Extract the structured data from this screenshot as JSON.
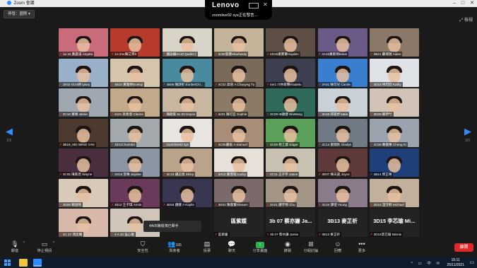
{
  "window": {
    "title": "Zoom 會議",
    "controls": [
      "–",
      "□",
      "✕"
    ]
  },
  "topbar": {
    "view_button": "停發：國際 ▾",
    "speaking": "zoomlive02 sys正在發言...",
    "fullscreen": "⤢ 檢視"
  },
  "lenovo": {
    "logo": "Lenovo"
  },
  "gallery": {
    "page_left": "1/3",
    "page_right": "3/3",
    "tiles": [
      {
        "name": "1a 15 黃晨溪 Angela",
        "bg": "#c96b7a"
      },
      {
        "name": "1A Zoe陳艾邦6",
        "bg": "#b83a2d"
      },
      {
        "name": "鍾詠姍4A10 Qudim (",
        "bg": "#d9d4c8"
      },
      {
        "name": "3c05張禮Hilarhasity",
        "bg": "#c4b59a"
      },
      {
        "name": "4D15潘寶寶Hayden",
        "bg": "#5e5047"
      },
      {
        "name": "4A15黃家晴katun",
        "bg": "#6b5a86"
      },
      {
        "name": "3B21 蕭瑞瑞 Aiden",
        "bg": "#8a7868"
      },
      {
        "name": "2E02 IS24婷 Ipsey",
        "bg": "#9ab0c8"
      },
      {
        "name": "4B10 黃雅婷Doeluji",
        "bg": "#d6c5ad"
      },
      {
        "name": "4B06 陳詩形 EunbeiChi...",
        "bg": "#4a8a9e"
      },
      {
        "name": "4C02 高晉 A Chauyng Tu",
        "bg": "#7a6a5a"
      },
      {
        "name": "4er1 IT林家聲Klu&Mu",
        "bg": "#3f3f52"
      },
      {
        "name": "3A01 陳可兒 Carole",
        "bg": "#3a7fcf"
      },
      {
        "name": "3D18 林可欣 Kathy",
        "bg": "#dfe3e8"
      },
      {
        "name": "3C18 黃樂 Jamie",
        "bg": "#9fa7b0"
      },
      {
        "name": "4c21 高希意 Clarice",
        "bg": "#c2a98a"
      },
      {
        "name": "陳朗家 5c 02 Hoyce",
        "bg": "#c8b6a0"
      },
      {
        "name": "4c01 陳可宜 Sophie",
        "bg": "#8a7a66"
      },
      {
        "name": "3C29 IB康健 WuWang",
        "bg": "#2f6a5a"
      },
      {
        "name": "3A18 邱家妤 katie",
        "bg": "#c9d0d6"
      },
      {
        "name": "3D28 鄭伊兮",
        "bg": "#d1c3b5"
      },
      {
        "name": "3B19_MO WING YAN",
        "bg": "#4d3a2e"
      },
      {
        "name": "4b31Charlotte",
        "bg": "#a3a8ad"
      },
      {
        "name": "zoomlive02 sys",
        "bg": "#e8e4df"
      },
      {
        "name": "3C05蕭振 A Samuel",
        "bg": "#a88e78"
      },
      {
        "name": "3C06 姓江晨 Edgar",
        "bg": "#5aa05a"
      },
      {
        "name": "4C14 劉曉秋 Gladys",
        "bg": "#6f7a85"
      },
      {
        "name": "4C08 賴嘉樂 Cheng Ki",
        "bg": "#9aa3ae"
      },
      {
        "name": "3C05 陳家焉 Wayne",
        "bg": "#4a2f3f"
      },
      {
        "name": "4D15 李樂 Jaydee",
        "bg": "#8c95a3"
      },
      {
        "name": "3C23 鍾志偉 Shiny",
        "bg": "#b9a38b"
      },
      {
        "name": "3A12 黃雪瑤 Lucky",
        "bg": "#e6e0d8"
      },
      {
        "name": "3C11 王子宇 Jason",
        "bg": "#c8c0b0"
      },
      {
        "name": "3D07 賴天晨 Joyce",
        "bg": "#5e3a3a"
      },
      {
        "name": "4B14 郭芷晴",
        "bg": "#1e3f7a"
      },
      {
        "name": "4D08 賴語晴",
        "bg": "#d8c9b8"
      },
      {
        "name": "4b12 王子琪 Annie",
        "bg": "#6b3a5a"
      },
      {
        "name": "4D04 鍾健 A Kaylie",
        "bg": "#3a3550"
      },
      {
        "name": "3D02 陳嘉賢Sheuen",
        "bg": "#7a6a6a"
      },
      {
        "name": "3A21 鍾宇晴 Chu",
        "bg": "#a39585"
      },
      {
        "name": "4C24 譚愷 Yeung",
        "bg": "#8a7a8a"
      },
      {
        "name": "3D16 溫守軒 Michael",
        "bg": "#c2b09c"
      },
      {
        "name": "4C 27 馮思曦",
        "bg": "#d8b8a8"
      },
      {
        "name": "4 A 33 吳心雅",
        "bg": "#cfc5b8"
      }
    ],
    "text_tiles": [
      {
        "big": "區紫媛",
        "name": "區紫媛"
      },
      {
        "big": "3b 07 蔡亦謙 Ja...",
        "name": "3b 07 蔡亦謙 Jamie"
      },
      {
        "big": "3B13 麥芷祈",
        "name": "3B13 麥芷祈"
      },
      {
        "big": "3D15 李芯瑜 Mi...",
        "name": "3D15李芯瑜 Minnie"
      }
    ]
  },
  "chat_popup": {
    "text": "4A05陳俊鴻已舉手"
  },
  "toolbar": {
    "mute": "靜音",
    "stop_video": "停止視訊",
    "security": "安全性",
    "participants": "與會者",
    "participant_count": "165",
    "polls": "投票",
    "chat": "聊天",
    "share": "分享畫面",
    "record": "錄製",
    "breakout": "分組討論",
    "reactions": "回應",
    "more": "更多",
    "end": "離開"
  },
  "taskbar": {
    "time": "15:11",
    "date": "25/11/2021",
    "tray": "^ ▭ 中 ✉"
  },
  "colors": {
    "accent": "#2d8cff",
    "end": "#e02828",
    "share": "#2bb24c",
    "mute_red": "#e53935"
  }
}
